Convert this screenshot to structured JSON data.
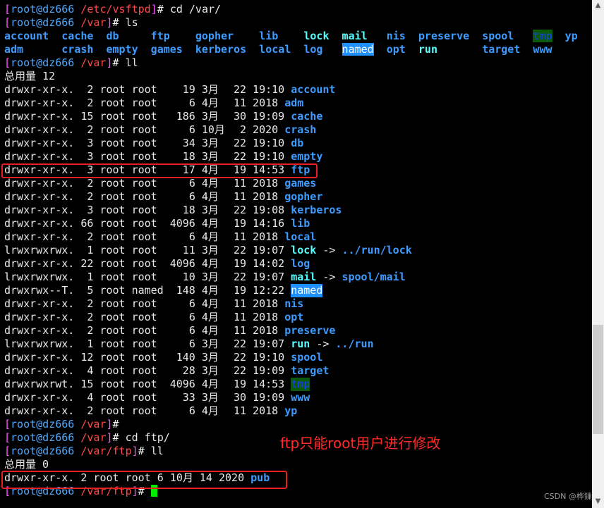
{
  "prompt_user": "root@dz666",
  "commands": [
    {
      "path": "/etc/vsftpd",
      "cmd": "cd /var/"
    },
    {
      "path": "/var",
      "cmd": "ls"
    },
    {
      "path": "/var",
      "cmd": "ll"
    },
    {
      "path": "/var",
      "cmd": ""
    },
    {
      "path": "/var",
      "cmd": "cd ftp/"
    },
    {
      "path": "/var/ftp",
      "cmd": "ll"
    },
    {
      "path": "/var/ftp",
      "cmd": ""
    }
  ],
  "ls_output": [
    [
      {
        "n": "account",
        "t": "dir"
      },
      {
        "n": "cache",
        "t": "dir"
      },
      {
        "n": "db",
        "t": "dir"
      },
      {
        "n": "ftp",
        "t": "dir"
      },
      {
        "n": "gopher",
        "t": "dir"
      },
      {
        "n": "lib",
        "t": "dir"
      },
      {
        "n": "lock",
        "t": "lnk"
      },
      {
        "n": "mail",
        "t": "lnk"
      },
      {
        "n": "nis",
        "t": "dir"
      },
      {
        "n": "preserve",
        "t": "dir"
      },
      {
        "n": "spool",
        "t": "dir"
      },
      {
        "n": "tmp",
        "t": "sticky"
      },
      {
        "n": "yp",
        "t": "dir"
      }
    ],
    [
      {
        "n": "adm",
        "t": "dir"
      },
      {
        "n": "crash",
        "t": "dir"
      },
      {
        "n": "empty",
        "t": "dir"
      },
      {
        "n": "games",
        "t": "dir"
      },
      {
        "n": "kerberos",
        "t": "dir"
      },
      {
        "n": "local",
        "t": "dir"
      },
      {
        "n": "log",
        "t": "dir"
      },
      {
        "n": "named",
        "t": "hl"
      },
      {
        "n": "opt",
        "t": "dir"
      },
      {
        "n": "run",
        "t": "lnk"
      },
      {
        "n": "target",
        "t": "dir"
      },
      {
        "n": "www",
        "t": "dir"
      }
    ]
  ],
  "var_total": "总用量 12",
  "var_listing": [
    [
      "drwxr-xr-x.",
      "2",
      "root",
      "root",
      "19",
      "3月",
      "22",
      "19:10",
      "account",
      "dir",
      ""
    ],
    [
      "drwxr-xr-x.",
      "2",
      "root",
      "root",
      "6",
      "4月",
      "11",
      "2018",
      "adm",
      "dir",
      ""
    ],
    [
      "drwxr-xr-x.",
      "15",
      "root",
      "root",
      "186",
      "3月",
      "30",
      "19:09",
      "cache",
      "dir",
      ""
    ],
    [
      "drwxr-xr-x.",
      "2",
      "root",
      "root",
      "6",
      "10月",
      "2",
      "2020",
      "crash",
      "dir",
      ""
    ],
    [
      "drwxr-xr-x.",
      "3",
      "root",
      "root",
      "34",
      "3月",
      "22",
      "19:10",
      "db",
      "dir",
      ""
    ],
    [
      "drwxr-xr-x.",
      "3",
      "root",
      "root",
      "18",
      "3月",
      "22",
      "19:10",
      "empty",
      "dir",
      ""
    ],
    [
      "drwxr-xr-x.",
      "3",
      "root",
      "root",
      "17",
      "4月",
      "19",
      "14:53",
      "ftp",
      "dir",
      ""
    ],
    [
      "drwxr-xr-x.",
      "2",
      "root",
      "root",
      "6",
      "4月",
      "11",
      "2018",
      "games",
      "dir",
      ""
    ],
    [
      "drwxr-xr-x.",
      "2",
      "root",
      "root",
      "6",
      "4月",
      "11",
      "2018",
      "gopher",
      "dir",
      ""
    ],
    [
      "drwxr-xr-x.",
      "3",
      "root",
      "root",
      "18",
      "3月",
      "22",
      "19:08",
      "kerberos",
      "dir",
      ""
    ],
    [
      "drwxr-xr-x.",
      "66",
      "root",
      "root",
      "4096",
      "4月",
      "19",
      "14:16",
      "lib",
      "dir",
      ""
    ],
    [
      "drwxr-xr-x.",
      "2",
      "root",
      "root",
      "6",
      "4月",
      "11",
      "2018",
      "local",
      "dir",
      ""
    ],
    [
      "lrwxrwxrwx.",
      "1",
      "root",
      "root",
      "11",
      "3月",
      "22",
      "19:07",
      "lock",
      "lnk",
      "../run/lock"
    ],
    [
      "drwxr-xr-x.",
      "22",
      "root",
      "root",
      "4096",
      "4月",
      "19",
      "14:02",
      "log",
      "dir",
      ""
    ],
    [
      "lrwxrwxrwx.",
      "1",
      "root",
      "root",
      "10",
      "3月",
      "22",
      "19:07",
      "mail",
      "lnk",
      "spool/mail"
    ],
    [
      "drwxrwx--T.",
      "5",
      "root",
      "named",
      "148",
      "4月",
      "19",
      "12:22",
      "named",
      "hl",
      ""
    ],
    [
      "drwxr-xr-x.",
      "2",
      "root",
      "root",
      "6",
      "4月",
      "11",
      "2018",
      "nis",
      "dir",
      ""
    ],
    [
      "drwxr-xr-x.",
      "2",
      "root",
      "root",
      "6",
      "4月",
      "11",
      "2018",
      "opt",
      "dir",
      ""
    ],
    [
      "drwxr-xr-x.",
      "2",
      "root",
      "root",
      "6",
      "4月",
      "11",
      "2018",
      "preserve",
      "dir",
      ""
    ],
    [
      "lrwxrwxrwx.",
      "1",
      "root",
      "root",
      "6",
      "3月",
      "22",
      "19:07",
      "run",
      "lnk",
      "../run"
    ],
    [
      "drwxr-xr-x.",
      "12",
      "root",
      "root",
      "140",
      "3月",
      "22",
      "19:10",
      "spool",
      "dir",
      ""
    ],
    [
      "drwxr-xr-x.",
      "4",
      "root",
      "root",
      "28",
      "3月",
      "22",
      "19:09",
      "target",
      "dir",
      ""
    ],
    [
      "drwxrwxrwt.",
      "15",
      "root",
      "root",
      "4096",
      "4月",
      "19",
      "14:53",
      "tmp",
      "sticky",
      ""
    ],
    [
      "drwxr-xr-x.",
      "4",
      "root",
      "root",
      "33",
      "3月",
      "30",
      "19:09",
      "www",
      "dir",
      ""
    ],
    [
      "drwxr-xr-x.",
      "2",
      "root",
      "root",
      "6",
      "4月",
      "11",
      "2018",
      "yp",
      "dir",
      ""
    ]
  ],
  "ftp_total": "总用量 0",
  "ftp_listing": {
    "prefix": "drwxr-xr-x. 2 root root 6 10月 14 2020",
    "name": "pub"
  },
  "annotation": "ftp只能root用户进行修改",
  "watermark": "CSDN @桦鏁",
  "colors": {
    "prompt_bracket": "#ff55ff",
    "prompt_host": "#4ea8ff",
    "prompt_path": "#ff4848",
    "directory": "#3d9cff",
    "symlink": "#55ffff",
    "highlight_box": "#e52020",
    "cursor": "#00ee00"
  }
}
